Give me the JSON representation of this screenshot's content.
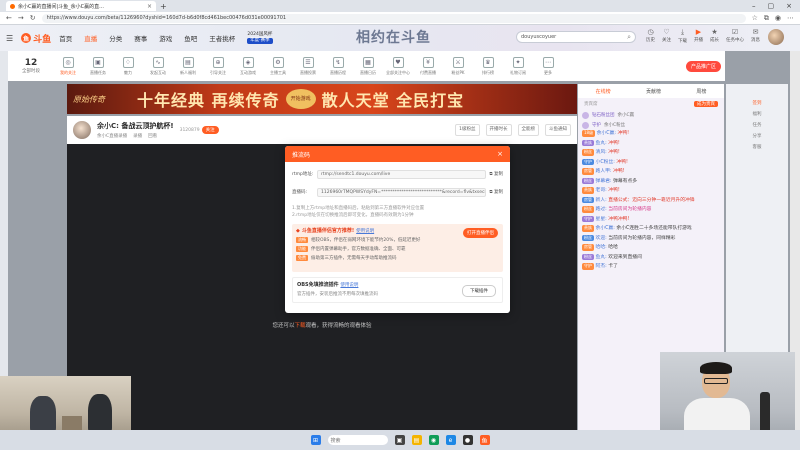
{
  "browser": {
    "tab_title": "余小C赢的直播间|斗鱼_余小C赢的直...",
    "url": "https://www.douyu.com/beta/1126960?dyshid=160d7d-b6d0f8cd461bec00476d031e00091701"
  },
  "header": {
    "nav": [
      "首页",
      "直播",
      "分类",
      "赛事",
      "游戏",
      "鱼吧",
      "王者挑杯"
    ],
    "nav_badge_top": "2024国风杯",
    "nav_badge_bottom": "年度·赛季",
    "banner_art": "相约在斗鱼",
    "search_placeholder": "douyuscoyuer",
    "actions": [
      "历史",
      "关注",
      "下载",
      "开播",
      "成长",
      "任务中心",
      "消息"
    ]
  },
  "subbar": {
    "follow_count": "12",
    "follow_label": "全部时段",
    "tools": [
      "我的关注",
      "直播任务",
      "魅力",
      "发起互动",
      "新人福利",
      "引导关注",
      "互动游戏",
      "主播工具",
      "直播投票",
      "直播历程",
      "直播日历",
      "全部关注中心",
      "付费直播",
      "粉丝PK",
      "排行榜",
      "礼物订阅",
      "更多"
    ],
    "promo": "产品推广区"
  },
  "ad": {
    "logo": "原始传奇",
    "slogan": "十年经典 再续传奇",
    "seal": "开始游戏",
    "slogan2": "散人天堂 全民打宝"
  },
  "room": {
    "nickname": "余小C:",
    "title": "备战云顶护航杯!",
    "follow_count": "3120879",
    "follow_btn": "关注",
    "meta": [
      "余小C直播录播",
      "录播",
      "回看"
    ],
    "right_items": [
      "1级粉丝",
      "开播时长",
      "全能榜",
      "斗鱼通知"
    ]
  },
  "video": {
    "tip_prefix": "您还可以",
    "tip_link": "下载",
    "tip_suffix": "观看，获得流畅的观看体验"
  },
  "rightpanel": {
    "tabs": [
      "在线榜",
      "贡献榜",
      "周榜"
    ],
    "sub_left": "贵宾席",
    "sub_right": "成为贵宾",
    "ranks": [
      {
        "name": "钻石粉丝团",
        "text": "余小C赢"
      },
      {
        "name": "守护",
        "text": "余小C粉丝"
      }
    ],
    "chat": [
      {
        "badge": "18级",
        "nick": "余小C赢:",
        "msg": "冲鸭!"
      },
      {
        "badge": "贵族",
        "nick": "鱼丸:",
        "msg": "冲鸭!"
      },
      {
        "badge": "粉丝",
        "nick": "清风:",
        "msg": "冲鸭!"
      },
      {
        "badge": "守护",
        "nick": "小C粉丝:",
        "msg": "冲鸭!"
      },
      {
        "badge": "房管",
        "nick": "路人甲:",
        "msg": "冲鸭!"
      },
      {
        "badge": "粉丝",
        "nick": "弹幕君:",
        "msg": "弹幕有点多"
      },
      {
        "badge": "贵族",
        "nick": "老哥:",
        "msg": "冲鸭!"
      },
      {
        "badge": "房管",
        "nick": "新人:",
        "msg": "直播公式：迈向三分钟一靠近月升的冲锋"
      },
      {
        "badge": "粉丝",
        "nick": "路过:",
        "msg": "当前房间为轮播内容"
      },
      {
        "badge": "守护",
        "nick": "星星:",
        "msg": "冲鸭冲鸭!"
      },
      {
        "badge": "贵族",
        "nick": "余小C赢:",
        "msg": "余小C连胜二十多场还能带队打游戏"
      },
      {
        "badge": "粉丝",
        "nick": "欢迎:",
        "msg": "当前房间为轮播内容，同样精彩"
      },
      {
        "badge": "房管",
        "nick": "哈哈:",
        "msg": "哈哈"
      },
      {
        "badge": "粉丝",
        "nick": "鱼丸:",
        "msg": "欢迎来到直播间"
      },
      {
        "badge": "守护",
        "nick": "阿杰:",
        "msg": "卡了"
      }
    ]
  },
  "side_icons": [
    "签到",
    "福利",
    "任务",
    "分享",
    "客服"
  ],
  "modal": {
    "title": "推流码",
    "rtmp_label": "rtmp地址:",
    "rtmp_value": "rtmp://sendtc1.douyu.com/live",
    "key_label": "直播码:",
    "key_value": "1126960rTMQPWSYdyFN=***************************&record=flv&txsecret",
    "copy": "复制",
    "hint1": "1.复制上方rtmp地址和直播码后，粘贴到第三方直播软件对应位置",
    "hint2": "2.rtmp地址仅在切换推流后即可变化，直播码有效期为1分钟",
    "rec_title": "斗鱼直播伴侣官方推荐!",
    "rec_more": "使用说明",
    "rec_open": "打开直播伴侣",
    "rec_lines": [
      {
        "tag": "流畅",
        "text": "相较OBS，伴侣在弱网环境下能节约20%，低延迟更好"
      },
      {
        "tag": "功能",
        "text": "伴侣内置弹幕助手，官方数据准确、全面、可靠"
      },
      {
        "tag": "免费",
        "text": "偷助第三方插件，无需每天手动帮助推流码"
      }
    ],
    "obs_title": "OBS免填推流插件",
    "obs_more": "使用说明",
    "obs_desc": "官方插件，安装后推流不用每次填推流码",
    "obs_btn": "下载插件"
  },
  "taskbar": {
    "search": "搜索"
  }
}
